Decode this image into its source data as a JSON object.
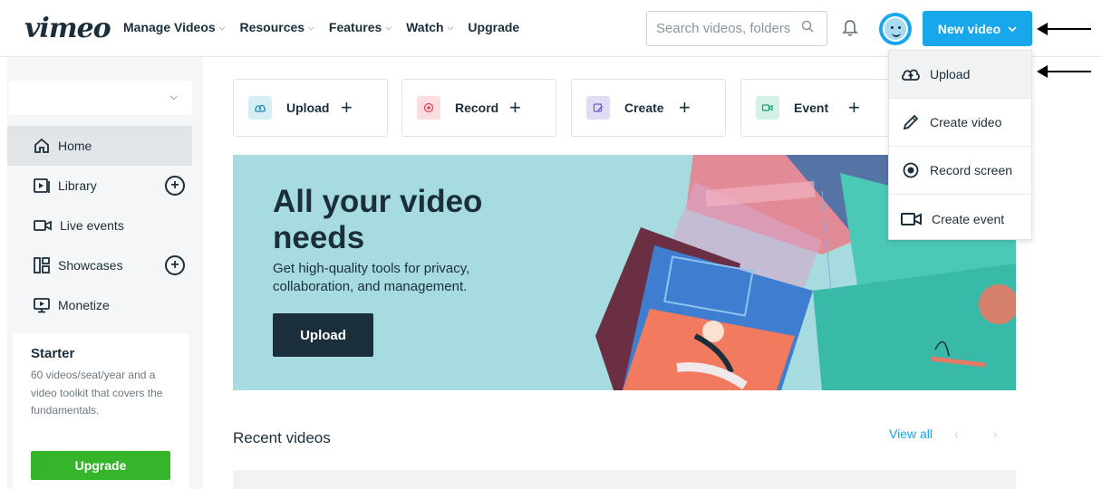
{
  "header": {
    "logo": "vimeo",
    "nav": [
      {
        "label": "Manage Videos",
        "has_dropdown": true
      },
      {
        "label": "Resources",
        "has_dropdown": true
      },
      {
        "label": "Features",
        "has_dropdown": true
      },
      {
        "label": "Watch",
        "has_dropdown": true
      },
      {
        "label": "Upgrade",
        "has_dropdown": false
      }
    ],
    "search_placeholder": "Search videos, folders",
    "new_video_label": "New video",
    "accent_color": "#17a7ea"
  },
  "new_video_menu": {
    "items": [
      {
        "label": "Upload",
        "icon": "cloud-upload-icon"
      },
      {
        "label": "Create video",
        "icon": "pencil-icon"
      },
      {
        "label": "Record screen",
        "icon": "record-icon"
      },
      {
        "label": "Create event",
        "icon": "camera-icon"
      }
    ]
  },
  "sidebar": {
    "selector_value": "",
    "items": [
      {
        "label": "Home",
        "icon": "home-icon",
        "active": true
      },
      {
        "label": "Library",
        "icon": "library-icon",
        "has_add": true
      },
      {
        "label": "Live events",
        "icon": "live-camera-icon"
      },
      {
        "label": "Showcases",
        "icon": "showcases-icon",
        "has_add": true
      },
      {
        "label": "Monetize",
        "icon": "monetize-icon"
      }
    ],
    "plan": {
      "title": "Starter",
      "description": "60 videos/seat/year and a video toolkit that covers the fundamentals.",
      "button_label": "Upgrade",
      "button_color": "#36b52b"
    }
  },
  "quick_actions": [
    {
      "label": "Upload",
      "icon": "upload-icon",
      "color": "#d6eef5"
    },
    {
      "label": "Record",
      "icon": "record-icon",
      "color": "#fbdde0"
    },
    {
      "label": "Create",
      "icon": "create-icon",
      "color": "#e1dcf6"
    },
    {
      "label": "Event",
      "icon": "event-icon",
      "color": "#d3f1e6"
    }
  ],
  "hero": {
    "title": "All your video needs",
    "subtitle": "Get high-quality tools for privacy, collaboration, and management.",
    "button_label": "Upload",
    "background_color": "#a6dcdf"
  },
  "recent": {
    "title": "Recent videos",
    "view_all": "View all",
    "prev": "‹",
    "next": "›"
  }
}
